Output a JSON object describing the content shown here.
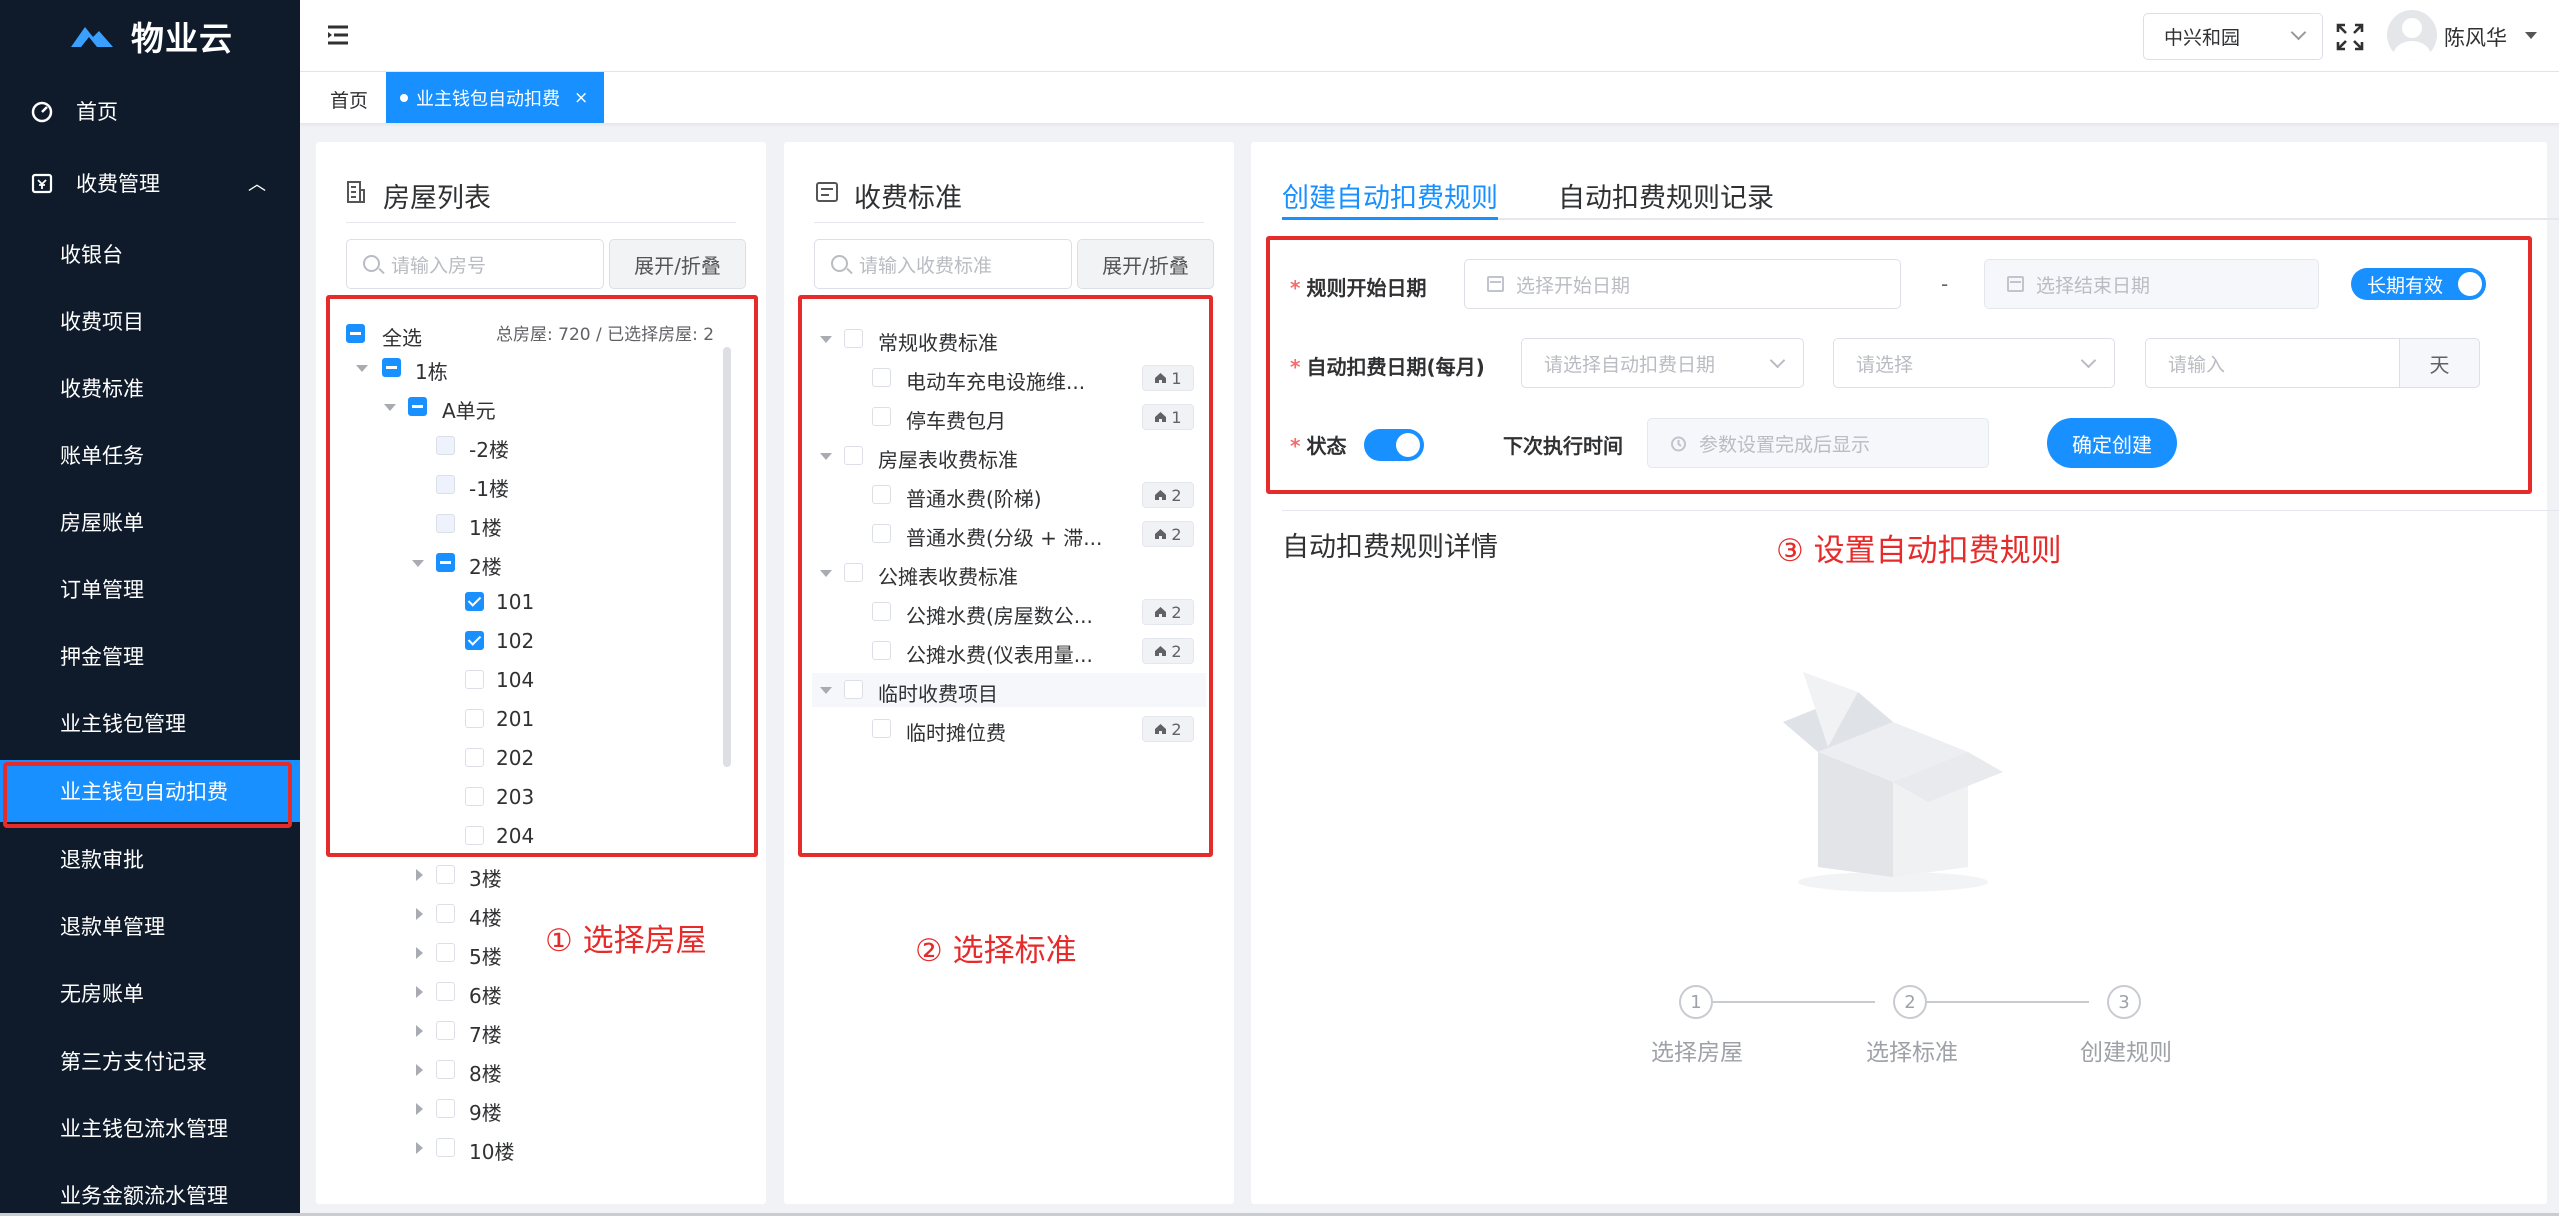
{
  "app": {
    "name": "物业云"
  },
  "sidebar": {
    "home": "首页",
    "group": "收费管理",
    "items": [
      {
        "label": "收银台"
      },
      {
        "label": "收费项目"
      },
      {
        "label": "收费标准"
      },
      {
        "label": "账单任务"
      },
      {
        "label": "房屋账单"
      },
      {
        "label": "订单管理"
      },
      {
        "label": "押金管理"
      },
      {
        "label": "业主钱包管理"
      },
      {
        "label": "业主钱包自动扣费",
        "active": true
      },
      {
        "label": "退款审批"
      },
      {
        "label": "退款单管理"
      },
      {
        "label": "无房账单"
      },
      {
        "label": "第三方支付记录"
      },
      {
        "label": "业主钱包流水管理"
      },
      {
        "label": "业务金额流水管理"
      }
    ]
  },
  "header": {
    "community": "中兴和园",
    "user": "陈风华"
  },
  "tabs": {
    "home": "首页",
    "active": "业主钱包自动扣费",
    "close": "×"
  },
  "house_panel": {
    "title": "房屋列表",
    "search_placeholder": "请输入房号",
    "toggle_button": "展开/折叠",
    "select_all": "全选",
    "summary": "总房屋: 720 / 已选择房屋: 2",
    "tree": {
      "building": "1栋",
      "unit": "A单元",
      "floors_top": [
        "-2楼",
        "-1楼",
        "1楼"
      ],
      "floor_open": "2楼",
      "rooms": [
        {
          "label": "101",
          "checked": true
        },
        {
          "label": "102",
          "checked": true
        },
        {
          "label": "104",
          "checked": false
        },
        {
          "label": "201",
          "checked": false
        },
        {
          "label": "202",
          "checked": false
        },
        {
          "label": "203",
          "checked": false
        },
        {
          "label": "204",
          "checked": false
        }
      ],
      "floors_bottom": [
        "3楼",
        "4楼",
        "5楼",
        "6楼",
        "7楼",
        "8楼",
        "9楼",
        "10楼"
      ]
    },
    "annotation": "① 选择房屋"
  },
  "standard_panel": {
    "title": "收费标准",
    "search_placeholder": "请输入收费标准",
    "toggle_button": "展开/折叠",
    "groups": [
      {
        "label": "常规收费标准",
        "items": [
          {
            "label": "电动车充电设施维...",
            "count": "1"
          },
          {
            "label": "停车费包月",
            "count": "1"
          }
        ]
      },
      {
        "label": "房屋表收费标准",
        "items": [
          {
            "label": "普通水费(阶梯)",
            "count": "2"
          },
          {
            "label": "普通水费(分级 + 滞...",
            "count": "2"
          }
        ]
      },
      {
        "label": "公摊表收费标准",
        "items": [
          {
            "label": "公摊水费(房屋数公...",
            "count": "2"
          },
          {
            "label": "公摊水费(仪表用量...",
            "count": "2"
          }
        ]
      },
      {
        "label": "临时收费项目",
        "items": [
          {
            "label": "临时摊位费",
            "count": "2"
          }
        ]
      }
    ],
    "annotation": "② 选择标准"
  },
  "rule_panel": {
    "tabs": [
      "创建自动扣费规则",
      "自动扣费规则记录"
    ],
    "start_label": "规则开始日期",
    "start_placeholder": "选择开始日期",
    "dash": "-",
    "end_placeholder": "选择结束日期",
    "long_term": "长期有效",
    "day_label": "自动扣费日期(每月)",
    "day_placeholder": "请选择自动扣费日期",
    "select_placeholder": "请选择",
    "input_placeholder": "请输入",
    "unit": "天",
    "status_label": "状态",
    "status_on": true,
    "next_label": "下次执行时间",
    "next_placeholder": "参数设置完成后显示",
    "confirm_button": "确定创建",
    "detail_title": "自动扣费规则详情",
    "annotation": "③ 设置自动扣费规则",
    "steps": [
      {
        "num": "1",
        "label": "选择房屋"
      },
      {
        "num": "2",
        "label": "选择标准"
      },
      {
        "num": "3",
        "label": "创建规则"
      }
    ]
  },
  "colors": {
    "primary": "#1890ff",
    "sidebar_bg": "#0f1b2a",
    "annotation": "#e62b2b"
  }
}
